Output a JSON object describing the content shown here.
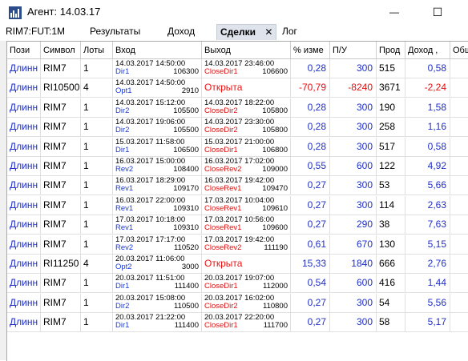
{
  "window": {
    "title": "Агент: 14.03.17",
    "minimize_glyph": "—",
    "maximize_glyph": "☐"
  },
  "toolbar": {
    "symbol": "RIM7:FUT:1M",
    "tabs": [
      {
        "label": "Результаты",
        "active": false
      },
      {
        "label": "Доход",
        "active": false
      },
      {
        "label": "Сделки",
        "active": true
      },
      {
        "label": "Лог",
        "active": false
      }
    ],
    "close_glyph": "✕"
  },
  "colors": {
    "position_blue": "#1f2fc8",
    "negative_red": "#e01010",
    "active_tab_bg": "#dfe4ec"
  },
  "table": {
    "headers": [
      "Пози",
      "Символ",
      "Лоты",
      "Вход",
      "Выход",
      "% изме",
      "П/У",
      "Прод",
      "Доход ,",
      "Общ"
    ],
    "rows": [
      {
        "pos": "Длинн",
        "symbol": "RIM7",
        "lots": "1",
        "entry_date": "14.03.2017 14:50:00",
        "entry_price": "106300",
        "entry_name": "Dir1",
        "exit_date": "14.03.2017 23:46:00",
        "exit_price": "106600",
        "exit_name": "CloseDir1",
        "exit_open": false,
        "pct": "0,28",
        "pl": "300",
        "bars": "515",
        "income": "0,58",
        "total": ""
      },
      {
        "pos": "Длинн",
        "symbol": "RI10500",
        "lots": "4",
        "entry_date": "14.03.2017 14:50:00",
        "entry_price": "2910",
        "entry_name": "Opt1",
        "exit_date": "",
        "exit_price": "",
        "exit_name": "Открыта",
        "exit_open": true,
        "pct": "-70,79",
        "pl": "-8240",
        "bars": "3671",
        "income": "-2,24",
        "total": ""
      },
      {
        "pos": "Длинн",
        "symbol": "RIM7",
        "lots": "1",
        "entry_date": "14.03.2017 15:12:00",
        "entry_price": "105500",
        "entry_name": "Dir2",
        "exit_date": "14.03.2017 18:22:00",
        "exit_price": "105800",
        "exit_name": "CloseDir2",
        "exit_open": false,
        "pct": "0,28",
        "pl": "300",
        "bars": "190",
        "income": "1,58",
        "total": ""
      },
      {
        "pos": "Длинн",
        "symbol": "RIM7",
        "lots": "1",
        "entry_date": "14.03.2017 19:06:00",
        "entry_price": "105500",
        "entry_name": "Dir2",
        "exit_date": "14.03.2017 23:30:00",
        "exit_price": "105800",
        "exit_name": "CloseDir2",
        "exit_open": false,
        "pct": "0,28",
        "pl": "300",
        "bars": "258",
        "income": "1,16",
        "total": ""
      },
      {
        "pos": "Длинн",
        "symbol": "RIM7",
        "lots": "1",
        "entry_date": "15.03.2017 11:58:00",
        "entry_price": "106500",
        "entry_name": "Dir1",
        "exit_date": "15.03.2017 21:00:00",
        "exit_price": "106800",
        "exit_name": "CloseDir1",
        "exit_open": false,
        "pct": "0,28",
        "pl": "300",
        "bars": "517",
        "income": "0,58",
        "total": ""
      },
      {
        "pos": "Длинн",
        "symbol": "RIM7",
        "lots": "1",
        "entry_date": "16.03.2017 15:00:00",
        "entry_price": "108400",
        "entry_name": "Rev2",
        "exit_date": "16.03.2017 17:02:00",
        "exit_price": "109000",
        "exit_name": "CloseRev2",
        "exit_open": false,
        "pct": "0,55",
        "pl": "600",
        "bars": "122",
        "income": "4,92",
        "total": ""
      },
      {
        "pos": "Длинн",
        "symbol": "RIM7",
        "lots": "1",
        "entry_date": "16.03.2017 18:29:00",
        "entry_price": "109170",
        "entry_name": "Rev1",
        "exit_date": "16.03.2017 19:42:00",
        "exit_price": "109470",
        "exit_name": "CloseRev1",
        "exit_open": false,
        "pct": "0,27",
        "pl": "300",
        "bars": "53",
        "income": "5,66",
        "total": ""
      },
      {
        "pos": "Длинн",
        "symbol": "RIM7",
        "lots": "1",
        "entry_date": "16.03.2017 22:00:00",
        "entry_price": "109310",
        "entry_name": "Rev1",
        "exit_date": "17.03.2017 10:04:00",
        "exit_price": "109610",
        "exit_name": "CloseRev1",
        "exit_open": false,
        "pct": "0,27",
        "pl": "300",
        "bars": "114",
        "income": "2,63",
        "total": ""
      },
      {
        "pos": "Длинн",
        "symbol": "RIM7",
        "lots": "1",
        "entry_date": "17.03.2017 10:18:00",
        "entry_price": "109310",
        "entry_name": "Rev1",
        "exit_date": "17.03.2017 10:56:00",
        "exit_price": "109600",
        "exit_name": "CloseRev1",
        "exit_open": false,
        "pct": "0,27",
        "pl": "290",
        "bars": "38",
        "income": "7,63",
        "total": ""
      },
      {
        "pos": "Длинн",
        "symbol": "RIM7",
        "lots": "1",
        "entry_date": "17.03.2017 17:17:00",
        "entry_price": "110520",
        "entry_name": "Rev2",
        "exit_date": "17.03.2017 19:42:00",
        "exit_price": "111190",
        "exit_name": "CloseRev2",
        "exit_open": false,
        "pct": "0,61",
        "pl": "670",
        "bars": "130",
        "income": "5,15",
        "total": ""
      },
      {
        "pos": "Длинн",
        "symbol": "RI11250",
        "lots": "4",
        "entry_date": "20.03.2017 11:06:00",
        "entry_price": "3000",
        "entry_name": "Opt2",
        "exit_date": "",
        "exit_price": "",
        "exit_name": "Открыта",
        "exit_open": true,
        "pct": "15,33",
        "pl": "1840",
        "bars": "666",
        "income": "2,76",
        "total": ""
      },
      {
        "pos": "Длинн",
        "symbol": "RIM7",
        "lots": "1",
        "entry_date": "20.03.2017 11:51:00",
        "entry_price": "111400",
        "entry_name": "Dir1",
        "exit_date": "20.03.2017 19:07:00",
        "exit_price": "112000",
        "exit_name": "CloseDir1",
        "exit_open": false,
        "pct": "0,54",
        "pl": "600",
        "bars": "416",
        "income": "1,44",
        "total": ""
      },
      {
        "pos": "Длинн",
        "symbol": "RIM7",
        "lots": "1",
        "entry_date": "20.03.2017 15:08:00",
        "entry_price": "110500",
        "entry_name": "Dir2",
        "exit_date": "20.03.2017 16:02:00",
        "exit_price": "110800",
        "exit_name": "CloseDir2",
        "exit_open": false,
        "pct": "0,27",
        "pl": "300",
        "bars": "54",
        "income": "5,56",
        "total": ""
      },
      {
        "pos": "Длинн",
        "symbol": "RIM7",
        "lots": "1",
        "entry_date": "20.03.2017 21:22:00",
        "entry_price": "111400",
        "entry_name": "Dir1",
        "exit_date": "20.03.2017 22:20:00",
        "exit_price": "111700",
        "exit_name": "CloseDir1",
        "exit_open": false,
        "pct": "0,27",
        "pl": "300",
        "bars": "58",
        "income": "5,17",
        "total": ""
      }
    ]
  }
}
